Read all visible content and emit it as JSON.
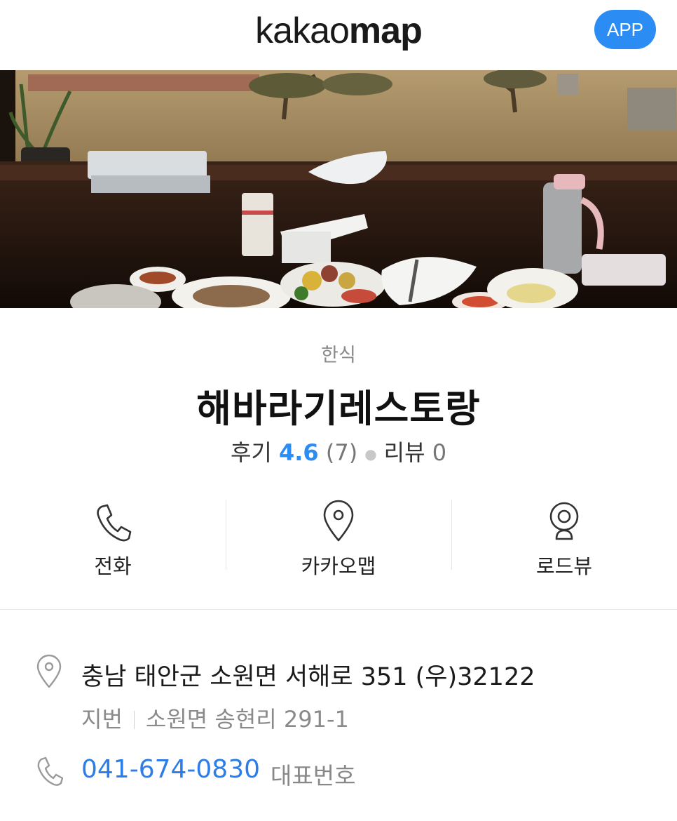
{
  "header": {
    "logo_part1": "kakao",
    "logo_part2": "map",
    "app_button": "APP"
  },
  "hero": {
    "icon": "restaurant-photo"
  },
  "place": {
    "category": "한식",
    "name": "해바라기레스토랑",
    "review_label": "후기",
    "rating": "4.6",
    "rating_count": "(7)",
    "blog_review_label": "리뷰",
    "blog_review_count": "0"
  },
  "actions": [
    {
      "label": "전화",
      "icon": "phone-icon"
    },
    {
      "label": "카카오맵",
      "icon": "map-pin-icon"
    },
    {
      "label": "로드뷰",
      "icon": "roadview-camera-icon"
    }
  ],
  "info": {
    "address": "충남 태안군 소원면 서해로 351 (우)32122",
    "jibun_label": "지번",
    "jibun_address": "소원면 송현리 291-1",
    "phone": "041-674-0830",
    "phone_label": "대표번호"
  },
  "colors": {
    "accent": "#2b8cf3",
    "link": "#2b7de9",
    "muted": "#8a8a8a"
  }
}
